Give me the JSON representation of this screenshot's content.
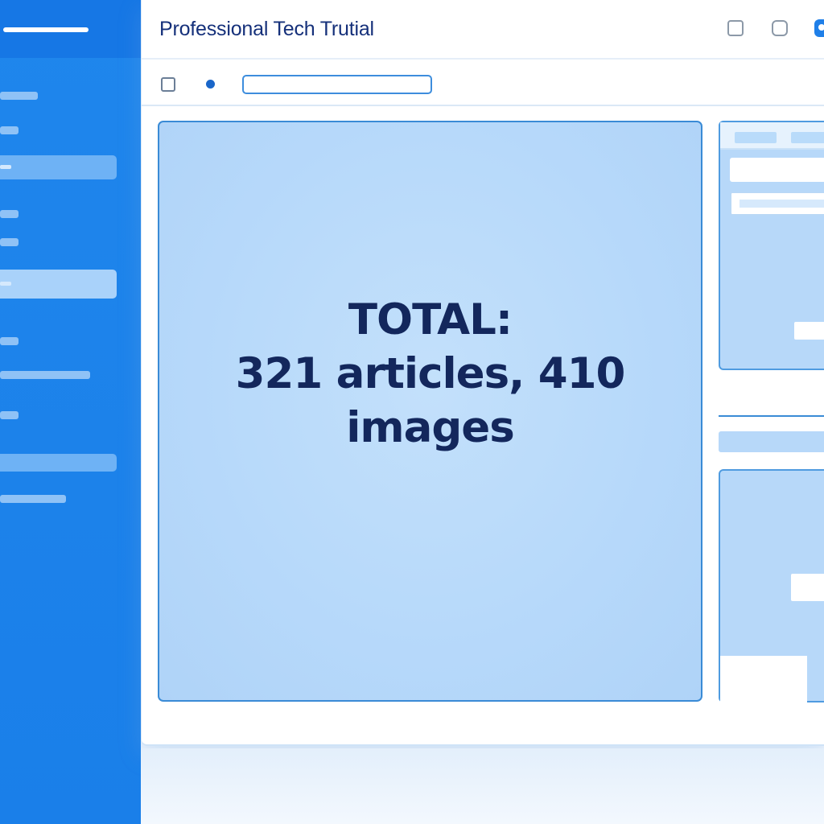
{
  "window": {
    "title": "Professional Tech Trutial"
  },
  "toolbar": {
    "search_value": ""
  },
  "main": {
    "total_line1": "TOTAL:",
    "total_line2": "321 articles, 410",
    "total_line3": "images"
  },
  "icons": {
    "window_controls": [
      "square-outline-icon",
      "rounded-square-icon",
      "circle-badge-icon"
    ],
    "toolbar": [
      "checkbox-icon",
      "dot-icon"
    ]
  },
  "colors": {
    "sidebar": "#1f86ec",
    "accent": "#1f7fe8",
    "panel": "#b7d9fa",
    "text_dark": "#13275c"
  }
}
